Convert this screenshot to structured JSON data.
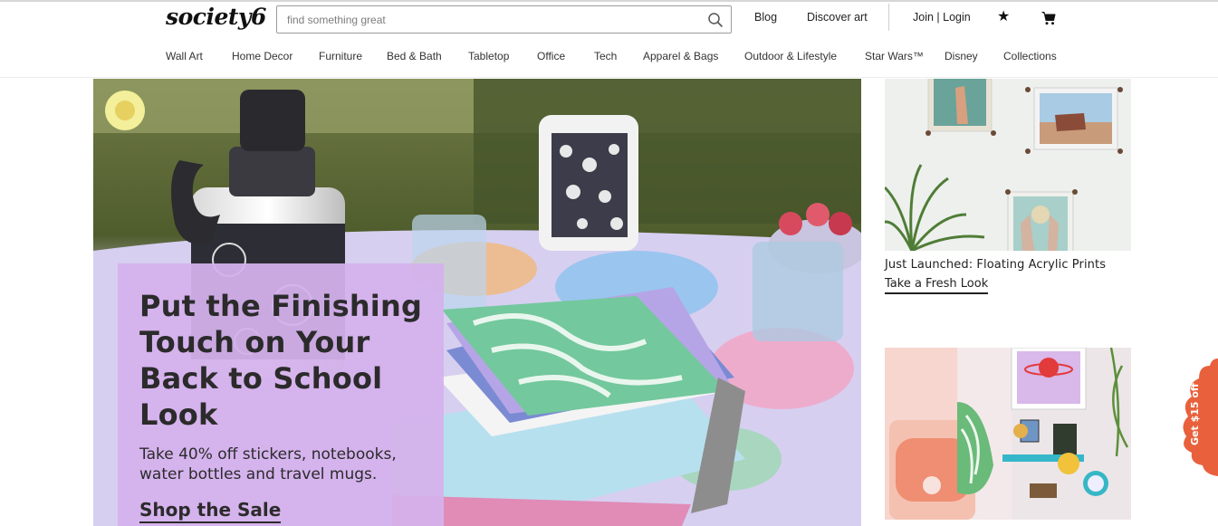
{
  "header": {
    "logo": "society6",
    "search": {
      "placeholder": "find something great",
      "value": ""
    },
    "links": {
      "blog": "Blog",
      "discover": "Discover art",
      "join_login": "Join | Login"
    },
    "icons": {
      "search": "search-icon",
      "wishlist": "star-icon",
      "cart": "cart-icon"
    }
  },
  "nav": {
    "items": [
      "Wall Art",
      "Home Decor",
      "Furniture",
      "Bed & Bath",
      "Tabletop",
      "Office",
      "Tech",
      "Apparel & Bags",
      "Outdoor & Lifestyle",
      "Star Wars™",
      "Disney",
      "Collections"
    ]
  },
  "hero": {
    "headline": "Put the Finishing Touch on Your Back to School Look",
    "subtext": "Take 40% off stickers, notebooks, water bottles and travel mugs.",
    "cta": "Shop the Sale"
  },
  "tiles": [
    {
      "title": "Just Launched: Floating Acrylic Prints",
      "cta": "Take a Fresh Look"
    }
  ],
  "side_tab": {
    "label": "Get $15 off"
  },
  "colors": {
    "promo_overlay": "#D5B1EC",
    "side_tab": "#E8613C",
    "text": "#2B2B2B"
  }
}
